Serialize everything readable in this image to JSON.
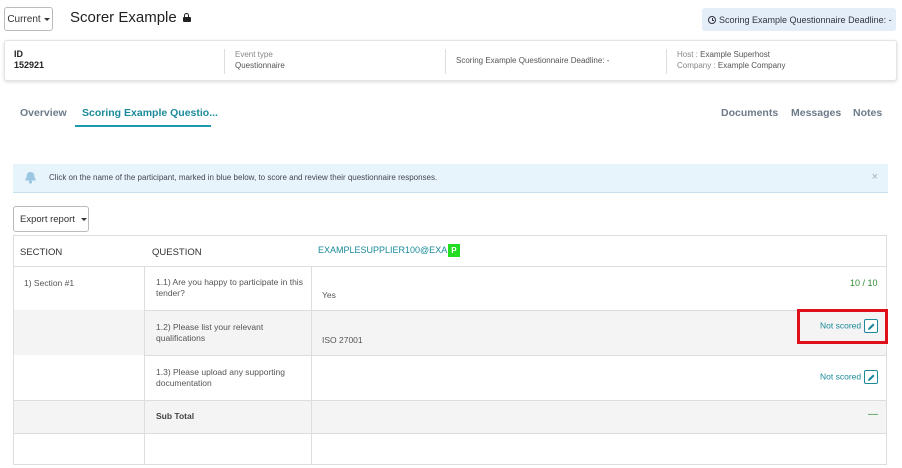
{
  "header": {
    "current_label": "Current",
    "title": "Scorer Example",
    "deadline_pill": "Scoring Example Questionnaire Deadline: -"
  },
  "info": {
    "id_label": "ID",
    "id_value": "152921",
    "event_type_label": "Event type",
    "event_type_value": "Questionnaire",
    "deadline": "Scoring Example Questionnaire Deadline: -",
    "host_label": "Host :",
    "host_value": "Example Superhost",
    "company_label": "Company :",
    "company_value": "Example Company"
  },
  "tabs": {
    "overview": "Overview",
    "scoring": "Scoring Example Questio...",
    "documents": "Documents",
    "messages": "Messages",
    "notes": "Notes"
  },
  "alert": {
    "text": "Click on the name of the participant, marked in blue below, to score and review their questionnaire responses.",
    "close": "×"
  },
  "export": {
    "label": "Export report"
  },
  "table": {
    "headers": {
      "section": "SECTION",
      "question": "QUESTION"
    },
    "supplier": {
      "name": "EXAMPLESUPPLIER100@EXA",
      "badge": "P"
    },
    "section_name": "1) Section #1",
    "rows": [
      {
        "question": "1.1) Are you happy to participate in this tender?",
        "answer": "Yes",
        "score": "10 / 10"
      },
      {
        "question": "1.2) Please list your relevant qualifications",
        "answer": "ISO 27001",
        "score": "Not scored"
      },
      {
        "question": "1.3) Please upload any supporting documentation",
        "answer": "",
        "score": "Not scored"
      }
    ],
    "subtotal_label": "Sub Total",
    "subtotal_value": "—"
  },
  "colors": {
    "accent": "#1a8a9a",
    "score_green": "#2f8a2f",
    "badge_green": "#22dd22",
    "highlight_red": "#e0101a",
    "alert_bg": "#e8f4fb"
  }
}
